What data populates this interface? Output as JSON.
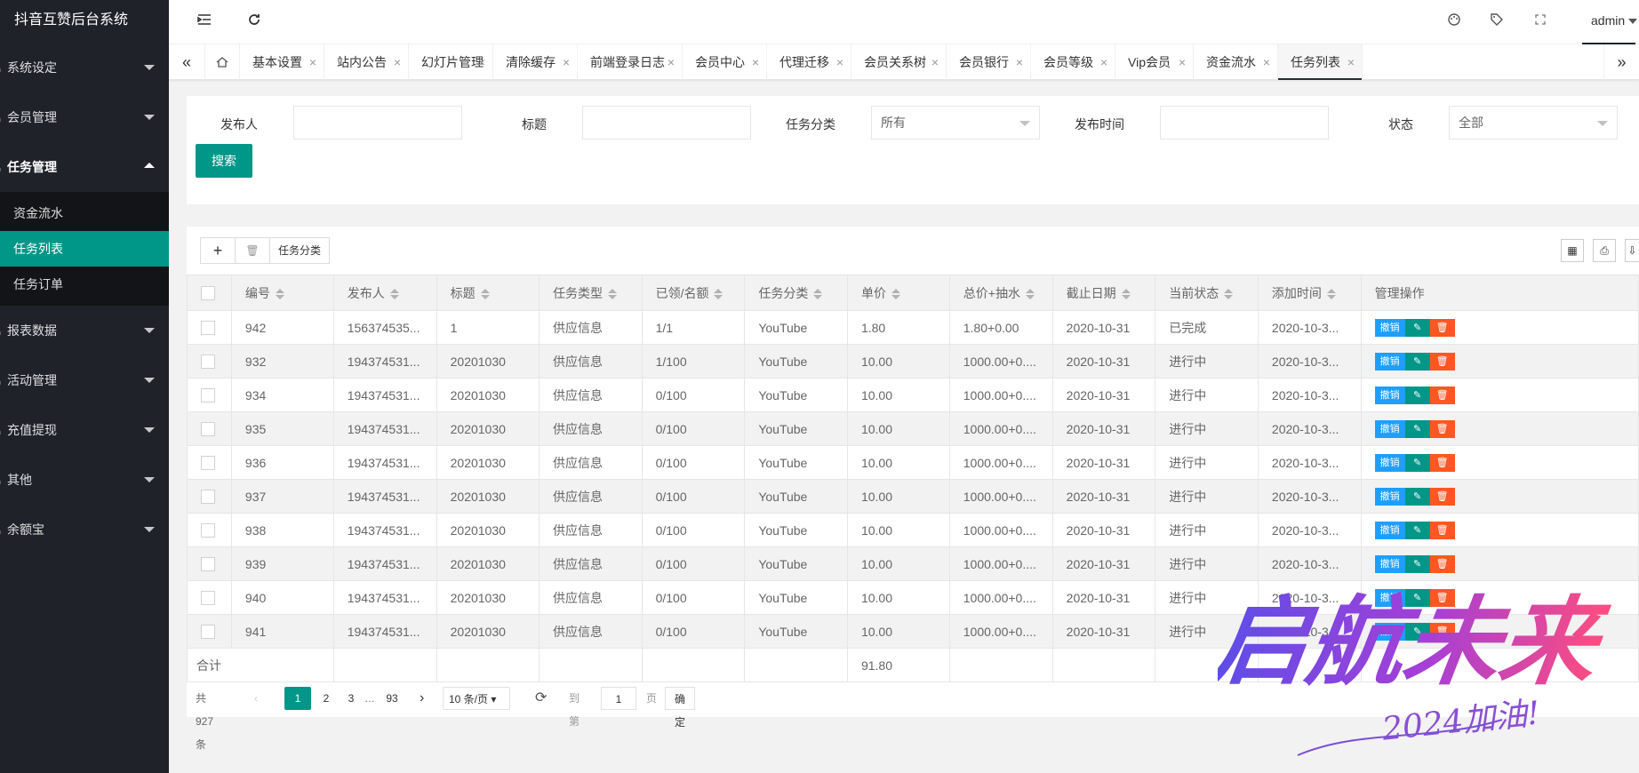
{
  "app": {
    "title": "抖音互赞后台系统"
  },
  "sidebar": {
    "items": [
      {
        "label": "系统设定",
        "open": false
      },
      {
        "label": "会员管理",
        "open": false
      },
      {
        "label": "任务管理",
        "open": true,
        "children": [
          {
            "label": "资金流水",
            "active": false
          },
          {
            "label": "任务列表",
            "active": true
          },
          {
            "label": "任务订单",
            "active": false
          }
        ]
      },
      {
        "label": "报表数据",
        "open": false
      },
      {
        "label": "活动管理",
        "open": false
      },
      {
        "label": "充值提现",
        "open": false
      },
      {
        "label": "其他",
        "open": false
      },
      {
        "label": "余额宝",
        "open": false
      }
    ]
  },
  "header": {
    "icons": [
      "menu-fold-icon",
      "refresh-icon",
      "theme-icon",
      "tag-icon",
      "fullscreen-icon"
    ],
    "user": "admin"
  },
  "tabs": {
    "items": [
      {
        "label": "基本设置"
      },
      {
        "label": "站内公告"
      },
      {
        "label": "幻灯片管理"
      },
      {
        "label": "清除缓存"
      },
      {
        "label": "前端登录日志"
      },
      {
        "label": "会员中心"
      },
      {
        "label": "代理迁移"
      },
      {
        "label": "会员关系树"
      },
      {
        "label": "会员银行"
      },
      {
        "label": "会员等级"
      },
      {
        "label": "Vip会员"
      },
      {
        "label": "资金流水"
      },
      {
        "label": "任务列表",
        "active": true
      }
    ],
    "close_glyph": "×"
  },
  "filters": {
    "publisher_label": "发布人",
    "publisher_value": "",
    "title_label": "标题",
    "title_value": "",
    "category_label": "任务分类",
    "category_value": "所有",
    "date_label": "发布时间",
    "date_value": "",
    "status_label": "状态",
    "status_value": "全部",
    "search_button": "搜索"
  },
  "toolbar": {
    "add": "+",
    "delete": "🗑",
    "category": "任务分类"
  },
  "table": {
    "columns": [
      "编号",
      "发布人",
      "标题",
      "任务类型",
      "已领/名额",
      "任务分类",
      "单价",
      "总价+抽水",
      "截止日期",
      "当前状态",
      "添加时间",
      "管理操作"
    ],
    "rows": [
      [
        "942",
        "156374535...",
        "1",
        "供应信息",
        "1/1",
        "YouTube",
        "1.80",
        "1.80+0.00",
        "2020-10-31",
        "已完成",
        "2020-10-3..."
      ],
      [
        "932",
        "194374531...",
        "20201030",
        "供应信息",
        "1/100",
        "YouTube",
        "10.00",
        "1000.00+0....",
        "2020-10-31",
        "进行中",
        "2020-10-3..."
      ],
      [
        "934",
        "194374531...",
        "20201030",
        "供应信息",
        "0/100",
        "YouTube",
        "10.00",
        "1000.00+0....",
        "2020-10-31",
        "进行中",
        "2020-10-3..."
      ],
      [
        "935",
        "194374531...",
        "20201030",
        "供应信息",
        "0/100",
        "YouTube",
        "10.00",
        "1000.00+0....",
        "2020-10-31",
        "进行中",
        "2020-10-3..."
      ],
      [
        "936",
        "194374531...",
        "20201030",
        "供应信息",
        "0/100",
        "YouTube",
        "10.00",
        "1000.00+0....",
        "2020-10-31",
        "进行中",
        "2020-10-3..."
      ],
      [
        "937",
        "194374531...",
        "20201030",
        "供应信息",
        "0/100",
        "YouTube",
        "10.00",
        "1000.00+0....",
        "2020-10-31",
        "进行中",
        "2020-10-3..."
      ],
      [
        "938",
        "194374531...",
        "20201030",
        "供应信息",
        "0/100",
        "YouTube",
        "10.00",
        "1000.00+0....",
        "2020-10-31",
        "进行中",
        "2020-10-3..."
      ],
      [
        "939",
        "194374531...",
        "20201030",
        "供应信息",
        "0/100",
        "YouTube",
        "10.00",
        "1000.00+0....",
        "2020-10-31",
        "进行中",
        "2020-10-3..."
      ],
      [
        "940",
        "194374531...",
        "20201030",
        "供应信息",
        "0/100",
        "YouTube",
        "10.00",
        "1000.00+0....",
        "2020-10-31",
        "进行中",
        "2020-10-3..."
      ],
      [
        "941",
        "194374531...",
        "20201030",
        "供应信息",
        "0/100",
        "YouTube",
        "10.00",
        "1000.00+0....",
        "2020-10-31",
        "进行中",
        "2020-10-3..."
      ]
    ],
    "ops": {
      "revoke": "撤销",
      "edit": "✎",
      "delete": "🗑"
    },
    "total_label": "合计",
    "total_value": "91.80"
  },
  "pager": {
    "total": "共 927 条",
    "prev": "‹",
    "pages": [
      "1",
      "2",
      "3"
    ],
    "ellipsis": "…",
    "last": "93",
    "next": "›",
    "per_page": "10 条/页",
    "goto_label": "到第",
    "goto_value": "1",
    "page_unit": "页",
    "confirm": "确定"
  },
  "watermark": {
    "main": "启航未来",
    "sub": "2024加油!"
  },
  "colors": {
    "accent": "#009688",
    "sidebar": "#20222a",
    "revoke": "#1e9fff",
    "danger": "#ff5722"
  }
}
